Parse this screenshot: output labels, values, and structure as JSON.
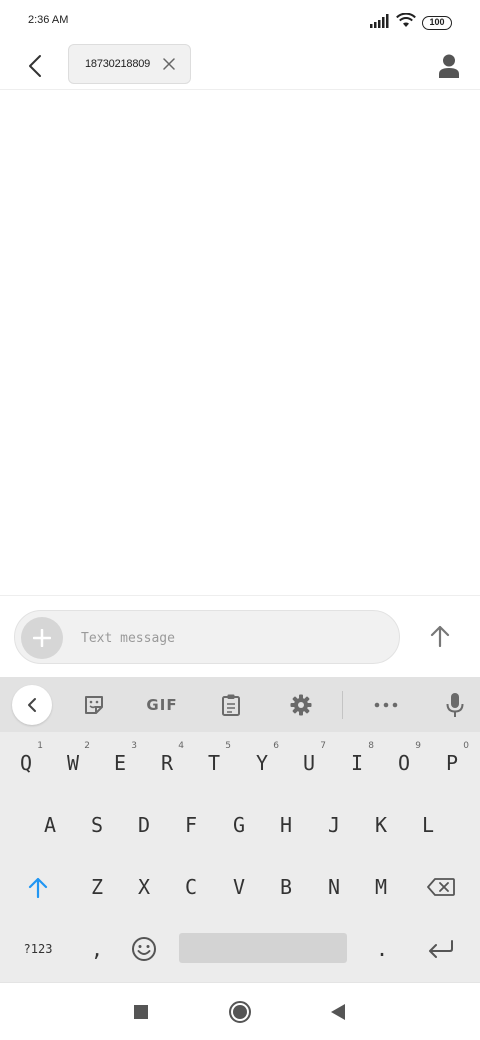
{
  "status_bar": {
    "time": "2:36 AM",
    "battery": "100"
  },
  "header": {
    "recipient": "18730218809"
  },
  "composer": {
    "placeholder": "Text message"
  },
  "keyboard": {
    "toolbar": {
      "gif_label": "GIF"
    },
    "row1": [
      {
        "key": "Q",
        "hint": "1"
      },
      {
        "key": "W",
        "hint": "2"
      },
      {
        "key": "E",
        "hint": "3"
      },
      {
        "key": "R",
        "hint": "4"
      },
      {
        "key": "T",
        "hint": "5"
      },
      {
        "key": "Y",
        "hint": "6"
      },
      {
        "key": "U",
        "hint": "7"
      },
      {
        "key": "I",
        "hint": "8"
      },
      {
        "key": "O",
        "hint": "9"
      },
      {
        "key": "P",
        "hint": "0"
      }
    ],
    "row2": [
      "A",
      "S",
      "D",
      "F",
      "G",
      "H",
      "J",
      "K",
      "L"
    ],
    "row3": [
      "Z",
      "X",
      "C",
      "V",
      "B",
      "N",
      "M"
    ],
    "row4": {
      "symbols": "?123",
      "comma": ",",
      "period": "."
    }
  },
  "colors": {
    "accent": "#2196f3",
    "icon_gray": "#6a6a6a"
  }
}
